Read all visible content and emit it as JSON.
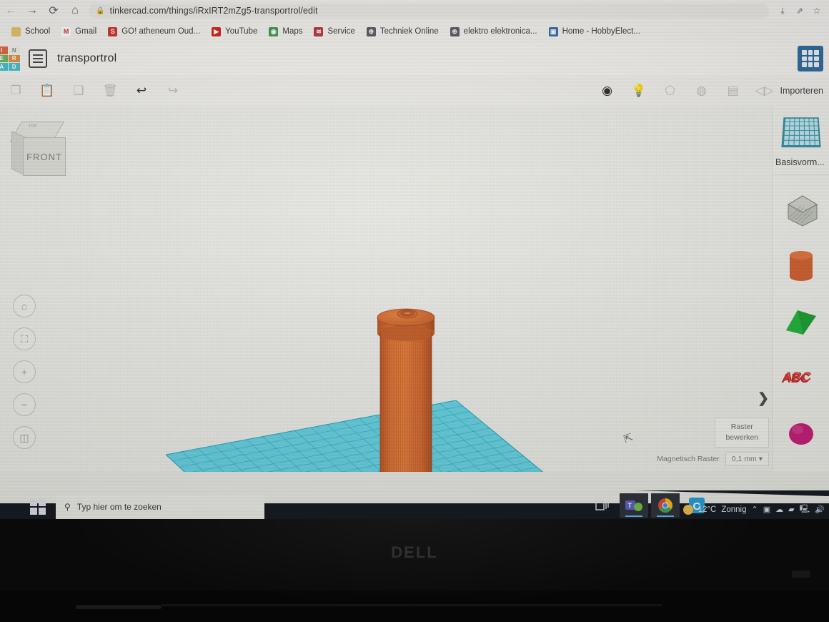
{
  "browser": {
    "back_icon": "←",
    "forward_icon": "→",
    "reload_icon": "⟳",
    "home_icon": "⌂",
    "lock_icon": "🔒",
    "url": "tinkercad.com/things/iRxIRT2mZg5-transportrol/edit",
    "right_icons": [
      {
        "name": "download-icon",
        "glyph": "⤓"
      },
      {
        "name": "share-icon",
        "glyph": "⇗"
      },
      {
        "name": "bookmark-star-icon",
        "glyph": "☆"
      }
    ],
    "bookmarks": [
      {
        "label": "School",
        "favicon_text": "",
        "favicon_color": "#e8c463"
      },
      {
        "label": "Gmail",
        "favicon_text": "M",
        "favicon_color": "#ffffff"
      },
      {
        "label": "GO! atheneum Oud...",
        "favicon_text": "S",
        "favicon_color": "#d8322c"
      },
      {
        "label": "YouTube",
        "favicon_text": "▶",
        "favicon_color": "#e0201a"
      },
      {
        "label": "Maps",
        "favicon_text": "◉",
        "favicon_color": "#3f9b4f"
      },
      {
        "label": "Service",
        "favicon_text": "≋",
        "favicon_color": "#c6343a"
      },
      {
        "label": "Techniek Online",
        "favicon_text": "⊕",
        "favicon_color": "#5b5e62"
      },
      {
        "label": "elektro elektronica...",
        "favicon_text": "⊕",
        "favicon_color": "#5b5e62"
      },
      {
        "label": "Home - HobbyElect...",
        "favicon_text": "▣",
        "favicon_color": "#2f6fb5"
      }
    ]
  },
  "app": {
    "logo_letters": [
      "I",
      "N",
      "E",
      "R",
      "A",
      "D"
    ],
    "logo_colors": [
      "#e8663a",
      "#f0f0ea",
      "#6db55b",
      "#e8913a",
      "#3fc4cf",
      "#3fc4cf"
    ],
    "document_title": "transportrol",
    "apps_button_name": "apps-grid-button"
  },
  "toolbar": {
    "left": [
      {
        "name": "copy-button",
        "glyph": "❐",
        "state": "faint"
      },
      {
        "name": "paste-button",
        "glyph": "📋",
        "state": "normal"
      },
      {
        "name": "duplicate-button",
        "glyph": "❑",
        "state": "faint"
      },
      {
        "name": "delete-button",
        "glyph": "🗑",
        "state": "faint"
      },
      {
        "name": "undo-button",
        "glyph": "↩",
        "state": "strong"
      },
      {
        "name": "redo-button",
        "glyph": "↪",
        "state": "faint"
      }
    ],
    "right": [
      {
        "name": "solid-hole-button",
        "glyph": "◉",
        "state": "strong"
      },
      {
        "name": "light-bulb-button",
        "glyph": "💡",
        "state": "faint"
      },
      {
        "name": "group-button",
        "glyph": "⬠",
        "state": "faint"
      },
      {
        "name": "ungroup-button",
        "glyph": "◍",
        "state": "faint"
      },
      {
        "name": "align-button",
        "glyph": "▤",
        "state": "faint"
      },
      {
        "name": "mirror-button",
        "glyph": "◁▷",
        "state": "faint"
      }
    ],
    "import_label": "Importeren"
  },
  "canvas": {
    "view_cube": {
      "front_label": "FRONT",
      "top_label": "TOP"
    },
    "nav_buttons": [
      {
        "name": "home-view-button",
        "glyph": "⌂"
      },
      {
        "name": "fit-to-view-button",
        "glyph": "⛶"
      },
      {
        "name": "zoom-in-button",
        "glyph": "+"
      },
      {
        "name": "zoom-out-button",
        "glyph": "−"
      },
      {
        "name": "perspective-toggle-button",
        "glyph": "◫"
      }
    ],
    "collapse_chevron": "❯",
    "cursor_glyph": "⇱",
    "workplane_color": "#4cd2e6",
    "model_color": "#e8702a"
  },
  "grid_controls": {
    "edit_grid_label_line1": "Raster",
    "edit_grid_label_line2": "bewerken",
    "snap_grid_label": "Magnetisch Raster",
    "snap_value": "0,1 mm",
    "snap_caret": "▾"
  },
  "shapes_panel": {
    "basisvormen_label": "Basisvorm...",
    "grid_thumb_name": "workplane-thumbnail",
    "shapes": [
      {
        "name": "shape-box",
        "color": "#b9bbb3"
      },
      {
        "name": "shape-cylinder",
        "color": "#d95f2a"
      },
      {
        "name": "shape-roof",
        "color": "#13a32b"
      },
      {
        "name": "shape-text",
        "color": "#cc2222"
      },
      {
        "name": "shape-sphere",
        "color": "#d01a7a"
      }
    ]
  },
  "taskbar": {
    "search_placeholder": "Typ hier om te zoeken",
    "search_icon": "search-icon",
    "items": [
      {
        "name": "task-view-button",
        "glyph": "❐"
      },
      {
        "name": "microsoft-teams-button",
        "glyph": "T"
      },
      {
        "name": "google-chrome-button",
        "glyph": "◉"
      },
      {
        "name": "app-c-button",
        "glyph": "C"
      }
    ],
    "weather_temp": "12°C",
    "weather_text": "Zonnig",
    "tray_caret": "⌃",
    "tray_icons": [
      {
        "name": "screenshot-tray-icon",
        "glyph": "▣"
      },
      {
        "name": "onedrive-tray-icon",
        "glyph": "☁"
      },
      {
        "name": "folder-tray-icon",
        "glyph": "▰"
      },
      {
        "name": "display-tray-icon",
        "glyph": "🖳"
      },
      {
        "name": "volume-tray-icon",
        "glyph": "🔊"
      }
    ]
  },
  "hardware": {
    "brand": "DELL"
  }
}
